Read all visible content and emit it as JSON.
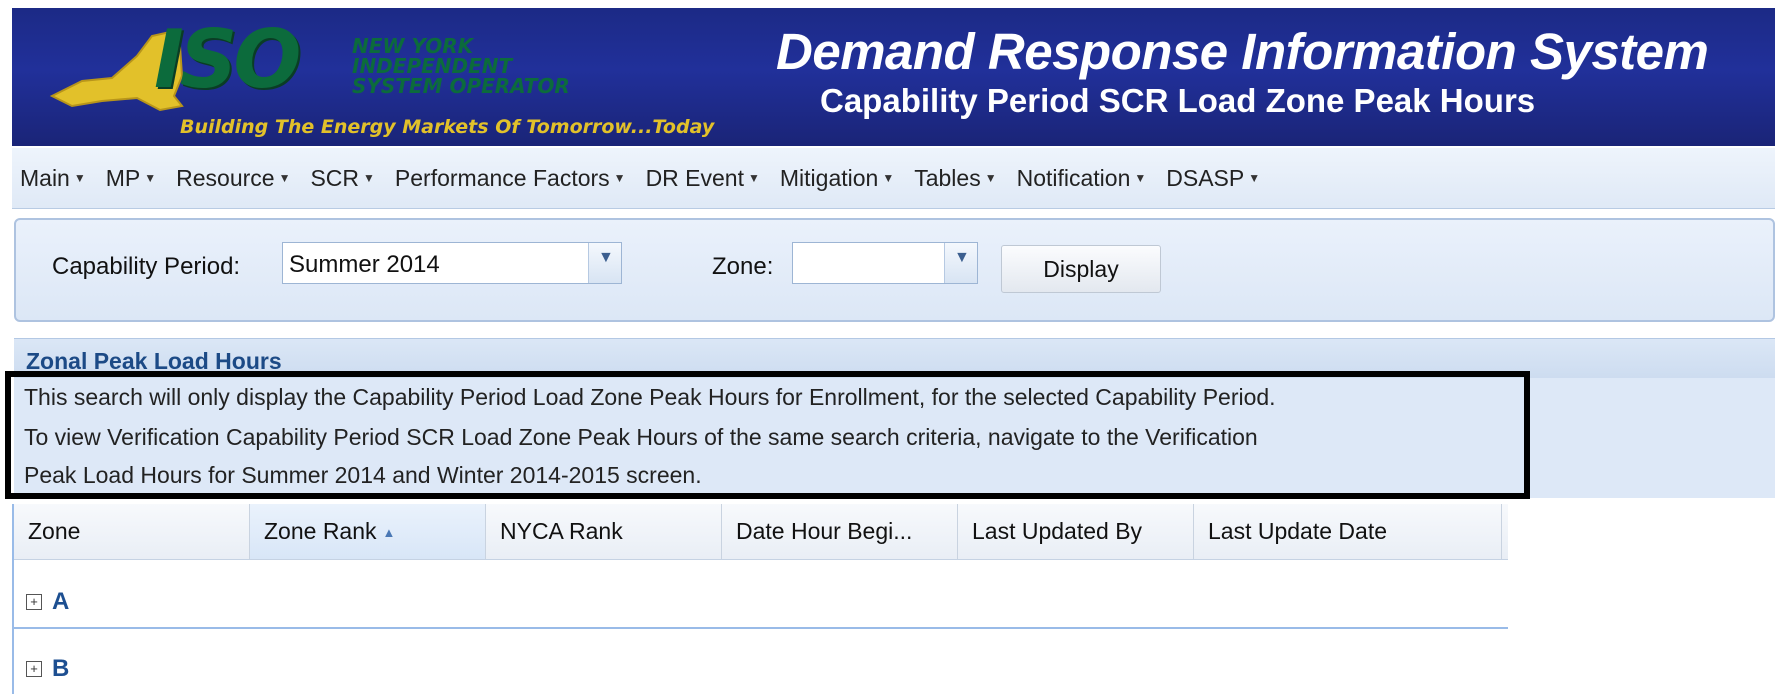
{
  "header": {
    "logo_text": "ISO",
    "logo_lines": [
      "NEW YORK",
      "INDEPENDENT",
      "SYSTEM OPERATOR"
    ],
    "tagline": "Building The Energy Markets Of Tomorrow...Today",
    "title": "Demand Response Information System",
    "subtitle": "Capability Period SCR Load Zone Peak Hours"
  },
  "menu": {
    "items": [
      {
        "label": "Main"
      },
      {
        "label": "MP"
      },
      {
        "label": "Resource"
      },
      {
        "label": "SCR"
      },
      {
        "label": "Performance Factors"
      },
      {
        "label": "DR Event"
      },
      {
        "label": "Mitigation"
      },
      {
        "label": "Tables"
      },
      {
        "label": "Notification"
      },
      {
        "label": "DSASP"
      }
    ]
  },
  "search": {
    "capability_period_label": "Capability Period:",
    "capability_period_value": "Summer 2014",
    "zone_label": "Zone:",
    "zone_value": "",
    "display_button": "Display"
  },
  "panel": {
    "title": "Zonal Peak Load Hours",
    "info_lines": [
      "This search will only display the Capability Period Load Zone Peak Hours for Enrollment, for the selected Capability Period.",
      "To view Verification Capability Period SCR Load Zone Peak Hours of the same search criteria, navigate to the Verification",
      "Peak Load Hours for Summer 2014 and Winter 2014-2015 screen."
    ]
  },
  "grid": {
    "columns": [
      "Zone",
      "Zone Rank",
      "NYCA Rank",
      "Date Hour Begi...",
      "Last Updated By",
      "Last Update Date"
    ],
    "sorted_column": "Zone Rank",
    "groups": [
      {
        "label": "A",
        "expander": "+"
      },
      {
        "label": "B",
        "expander": "+"
      }
    ]
  },
  "colors": {
    "header_bg": "#1c2a86",
    "logo_green": "#0c6b3c",
    "tagline_gold": "#e2c12a",
    "panel_title": "#1c4a86",
    "group_label": "#1d4f91"
  },
  "icons": {
    "menu_caret": "caret-down-icon",
    "combo_trigger": "chevron-down-icon",
    "sort": "sort-asc-icon",
    "expander": "plus-square-icon"
  }
}
